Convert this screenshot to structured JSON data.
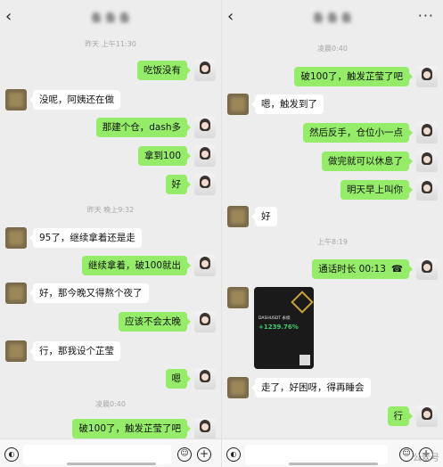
{
  "left": {
    "header": {
      "title": "备 备 备"
    },
    "timestamps": [
      "昨天 上午11:30",
      "昨天 晚上9:32",
      "凌晨0:40"
    ],
    "messages": [
      {
        "side": "me",
        "text": "吃饭没有"
      },
      {
        "side": "them",
        "text": "没呢，阿姨还在做"
      },
      {
        "side": "me",
        "text": "那建个仓，dash多"
      },
      {
        "side": "me",
        "text": "拿到100"
      },
      {
        "side": "me",
        "text": "好"
      },
      {
        "side": "them",
        "text": "95了，继续拿着还是走"
      },
      {
        "side": "me",
        "text": "继续拿着，破100就出"
      },
      {
        "side": "them",
        "text": "好，那今晚又得熬个夜了"
      },
      {
        "side": "me",
        "text": "应该不会太晚"
      },
      {
        "side": "them",
        "text": "行，那我设个芷莹"
      },
      {
        "side": "me",
        "text": "嗯"
      },
      {
        "side": "me",
        "text": "破100了，触发芷莹了吧"
      }
    ]
  },
  "right": {
    "header": {
      "title": "备 备 备"
    },
    "timestamps": [
      "凌晨0:40",
      "上午8:19"
    ],
    "messages": [
      {
        "side": "me",
        "text": "破100了，触发芷莹了吧"
      },
      {
        "side": "them",
        "text": "嗯，触发到了"
      },
      {
        "side": "me",
        "text": "然后反手，仓位小一点"
      },
      {
        "side": "me",
        "text": "做完就可以休息了"
      },
      {
        "side": "me",
        "text": "明天早上叫你"
      },
      {
        "side": "them",
        "text": "好"
      },
      {
        "side": "me",
        "text": "通话时长 00:13"
      },
      {
        "side": "them",
        "text": "走了，好困呀，得再睡会"
      },
      {
        "side": "me",
        "text": "行"
      }
    ],
    "card": {
      "label": "DASHUSDT 永续",
      "pct": "+1239.76%"
    }
  },
  "icons": {
    "back": "back-arrow-icon",
    "more": "more-icon",
    "voice": "voice-icon",
    "emoji": "emoji-icon",
    "plus": "plus-icon",
    "call": "phone-icon"
  },
  "colors": {
    "bubble_me": "#95ec69",
    "bubble_them": "#ffffff",
    "background": "#ededed"
  },
  "watermark": "公众号"
}
